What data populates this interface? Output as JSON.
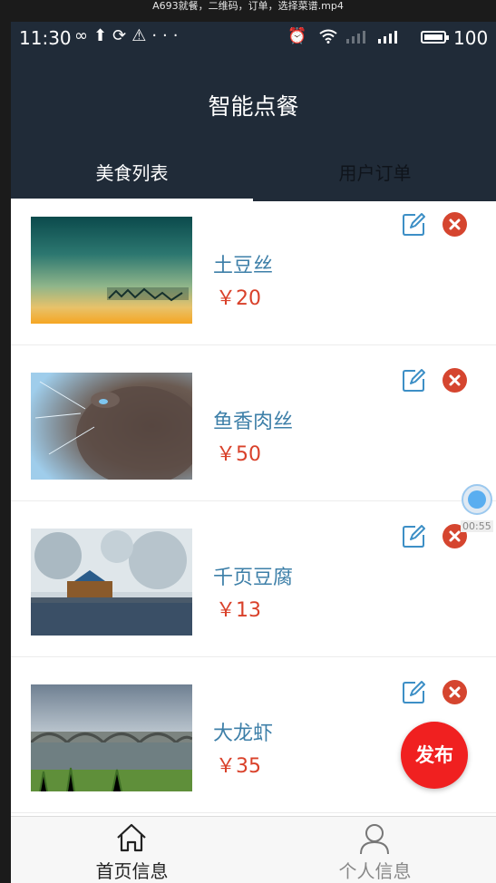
{
  "video_title": "A693就餐，二维码，订单，选择菜谱.mp4",
  "status_bar": {
    "time": "11:30",
    "left_icons": [
      "infinity-icon",
      "upload-icon",
      "sync-icon",
      "warning-icon",
      "more-icon"
    ],
    "right_icons": [
      "alarm-icon",
      "wifi-icon",
      "signal-icon",
      "signal-icon",
      "battery-icon"
    ],
    "battery_percent": "100"
  },
  "header": {
    "title": "智能点餐"
  },
  "tabs": [
    {
      "label": "美食列表",
      "active": true
    },
    {
      "label": "用户订单",
      "active": false
    }
  ],
  "food_list": [
    {
      "name": "土豆丝",
      "price": "￥20",
      "image": "teal-sunset-scene"
    },
    {
      "name": "鱼香肉丝",
      "price": "￥50",
      "image": "cat-looking-up"
    },
    {
      "name": "千页豆腐",
      "price": "￥13",
      "image": "frozen-lake-pavilion"
    },
    {
      "name": "大龙虾",
      "price": "￥35",
      "image": "arched-bridge-river"
    }
  ],
  "fab": {
    "label": "发布"
  },
  "float_widget": {
    "time": "00:55"
  },
  "bottom_nav": [
    {
      "label": "首页信息",
      "icon": "home-icon",
      "active": true
    },
    {
      "label": "个人信息",
      "icon": "user-icon",
      "active": false
    }
  ],
  "colors": {
    "header_bg": "#202b38",
    "food_name": "#3d7fa8",
    "price": "#d9412a",
    "delete": "#d5452f",
    "fab": "#f02020",
    "edit_icon": "#3d8fc6"
  }
}
